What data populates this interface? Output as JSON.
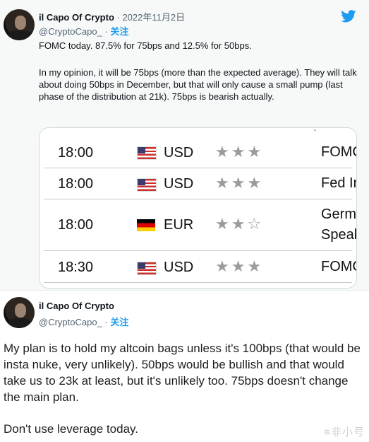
{
  "tweet1": {
    "author_name": "il Capo Of Crypto",
    "date": " · 2022年11月2日",
    "handle": "@CryptoCapo_",
    "separator": " · ",
    "follow_label": "关注",
    "line1": "FOMC today. 87.5% for 75bps and 12.5% for 50bps.",
    "paragraph2": "In my opinion, it will be 75bps (more than the expected average). They will talk about doing 50bps in December, but that will only cause a small pump (last phase of the distribution at 21k). 75bps is bearish actually."
  },
  "calendar": {
    "rows": [
      {
        "time": "18:00",
        "flag": "us-flag-icon",
        "currency": "USD",
        "stars": "★★★",
        "event": "FOMC"
      },
      {
        "time": "18:00",
        "flag": "us-flag-icon",
        "currency": "USD",
        "stars": "★★★",
        "event": "Fed In"
      },
      {
        "time": "18:00",
        "flag": "de-flag-icon",
        "currency": "EUR",
        "stars": "★★☆",
        "event": "Germa",
        "event2": "Speak"
      },
      {
        "time": "18:30",
        "flag": "us-flag-icon",
        "currency": "USD",
        "stars": "★★★",
        "event": "FOMC"
      }
    ]
  },
  "tweet2": {
    "author_name": "il Capo Of Crypto",
    "handle": "@CryptoCapo_",
    "separator": " · ",
    "follow_label": "关注",
    "paragraph1": "My plan is to hold my altcoin bags unless it's 100bps (that would be insta nuke, very unlikely). 50bps would be bullish and that would take us to 23k at least, but it's unlikely too. 75bps doesn't change the main plan.",
    "paragraph2": "Don't use leverage today."
  },
  "watermark": "≡非小号",
  "colors": {
    "accent": "#1d9bf0",
    "star": "#9b9b9b",
    "text": "#0f1419",
    "muted": "#536471"
  }
}
